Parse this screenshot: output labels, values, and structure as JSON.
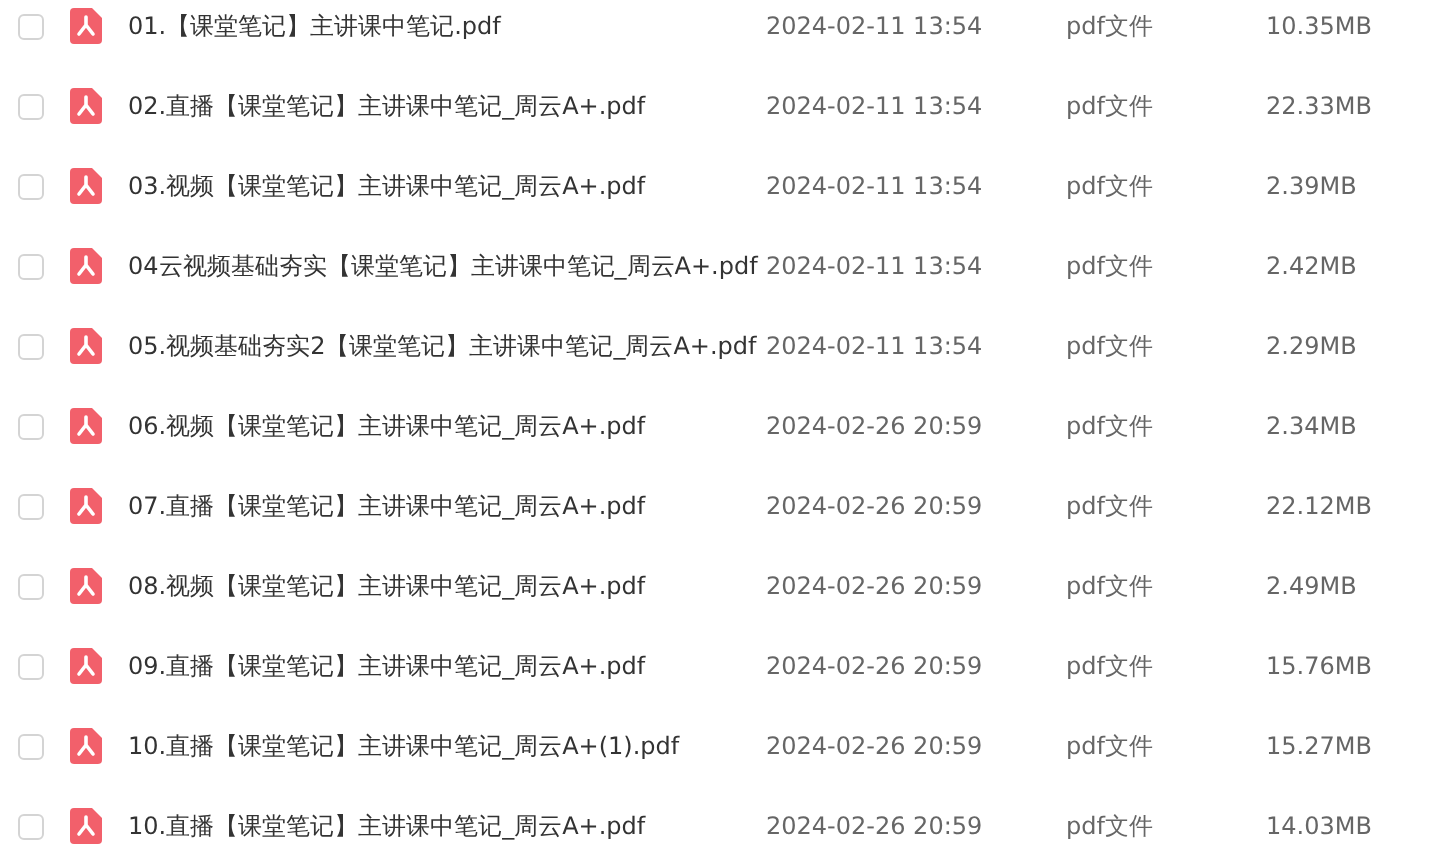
{
  "files": [
    {
      "name": "01.【课堂笔记】主讲课中笔记.pdf",
      "modified": "2024-02-11 13:54",
      "type": "pdf文件",
      "size": "10.35MB",
      "checked": false
    },
    {
      "name": "02.直播【课堂笔记】主讲课中笔记_周云A+.pdf",
      "modified": "2024-02-11 13:54",
      "type": "pdf文件",
      "size": "22.33MB",
      "checked": false
    },
    {
      "name": "03.视频【课堂笔记】主讲课中笔记_周云A+.pdf",
      "modified": "2024-02-11 13:54",
      "type": "pdf文件",
      "size": "2.39MB",
      "checked": false
    },
    {
      "name": "04云视频基础夯实【课堂笔记】主讲课中笔记_周云A+.pdf",
      "modified": "2024-02-11 13:54",
      "type": "pdf文件",
      "size": "2.42MB",
      "checked": false
    },
    {
      "name": "05.视频基础夯实2【课堂笔记】主讲课中笔记_周云A+.pdf",
      "modified": "2024-02-11 13:54",
      "type": "pdf文件",
      "size": "2.29MB",
      "checked": false
    },
    {
      "name": "06.视频【课堂笔记】主讲课中笔记_周云A+.pdf",
      "modified": "2024-02-26 20:59",
      "type": "pdf文件",
      "size": "2.34MB",
      "checked": false
    },
    {
      "name": "07.直播【课堂笔记】主讲课中笔记_周云A+.pdf",
      "modified": "2024-02-26 20:59",
      "type": "pdf文件",
      "size": "22.12MB",
      "checked": false
    },
    {
      "name": "08.视频【课堂笔记】主讲课中笔记_周云A+.pdf",
      "modified": "2024-02-26 20:59",
      "type": "pdf文件",
      "size": "2.49MB",
      "checked": false
    },
    {
      "name": "09.直播【课堂笔记】主讲课中笔记_周云A+.pdf",
      "modified": "2024-02-26 20:59",
      "type": "pdf文件",
      "size": "15.76MB",
      "checked": false
    },
    {
      "name": "10.直播【课堂笔记】主讲课中笔记_周云A+(1).pdf",
      "modified": "2024-02-26 20:59",
      "type": "pdf文件",
      "size": "15.27MB",
      "checked": false
    },
    {
      "name": "10.直播【课堂笔记】主讲课中笔记_周云A+.pdf",
      "modified": "2024-02-26 20:59",
      "type": "pdf文件",
      "size": "14.03MB",
      "checked": false
    }
  ]
}
